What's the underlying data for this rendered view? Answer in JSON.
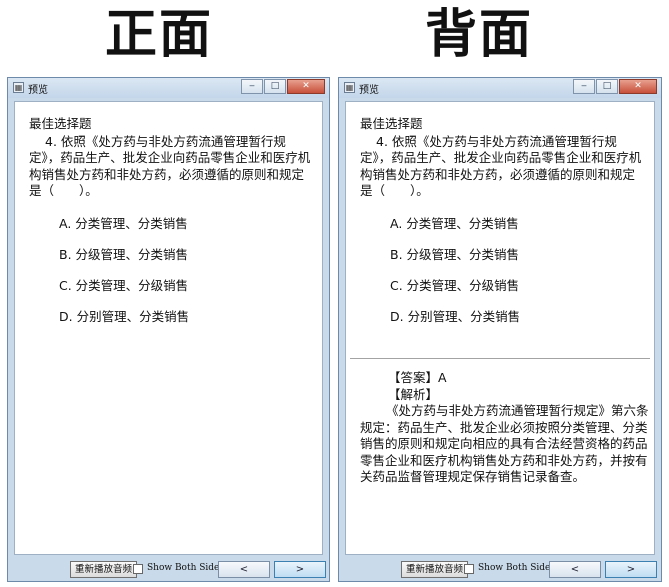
{
  "headers": {
    "front": "正面",
    "back": "背面"
  },
  "window": {
    "title": "预览",
    "min_label": "‒",
    "max_label": "□",
    "close_label": "✕"
  },
  "question": {
    "type_label": "最佳选择题",
    "text": "4. 依照《处方药与非处方药流通管理暂行规定》，药品生产、批发企业向药品零售企业和医疗机构销售处方药和非处方药，必须遵循的原则和规定是（　　）。",
    "options": [
      "A.  分类管理、分类销售",
      "B.  分级管理、分类销售",
      "C.  分类管理、分级销售",
      "D.  分别管理、分类销售"
    ]
  },
  "answer": {
    "answer_label": "【答案】A",
    "explanation_label": "【解析】",
    "explanation": "《处方药与非处方药流通管理暂行规定》第六条规定：药品生产、批发企业必须按照分类管理、分类销售的原则和规定向相应的具有合法经营资格的药品零售企业和医疗机构销售处方药和非处方药，并按有关药品监督管理规定保存销售记录备查。"
  },
  "footer": {
    "replay_label": "重新播放音频",
    "show_both_label": "Show Both Sides",
    "prev_label": "<",
    "next_label": ">"
  }
}
